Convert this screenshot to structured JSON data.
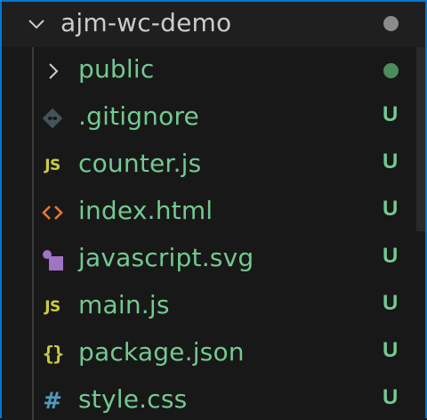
{
  "folder": {
    "name": "ajm-wc-demo",
    "expanded_icon": "chevron-down-icon",
    "status_dot_color": "#8b8b8b"
  },
  "items": [
    {
      "name": "public",
      "icon": "chevron-right-icon",
      "badge": "",
      "status": "dot",
      "status_dot_color": "#4e8b5c"
    },
    {
      "name": ".gitignore",
      "icon": "git-icon",
      "badge": "U"
    },
    {
      "name": "counter.js",
      "icon": "javascript-icon",
      "icon_text": "JS",
      "badge": "U"
    },
    {
      "name": "index.html",
      "icon": "html-icon",
      "badge": "U"
    },
    {
      "name": "javascript.svg",
      "icon": "svg-file-icon",
      "badge": "U"
    },
    {
      "name": "main.js",
      "icon": "javascript-icon",
      "icon_text": "JS",
      "badge": "U"
    },
    {
      "name": "package.json",
      "icon": "json-icon",
      "icon_text": "{}",
      "badge": "U"
    },
    {
      "name": "style.css",
      "icon": "css-icon",
      "icon_text": "#",
      "badge": "U"
    }
  ],
  "colors": {
    "untracked": "#73c991",
    "background": "#181818",
    "focus_border": "#0078d4",
    "folder_text": "#cccccc"
  }
}
